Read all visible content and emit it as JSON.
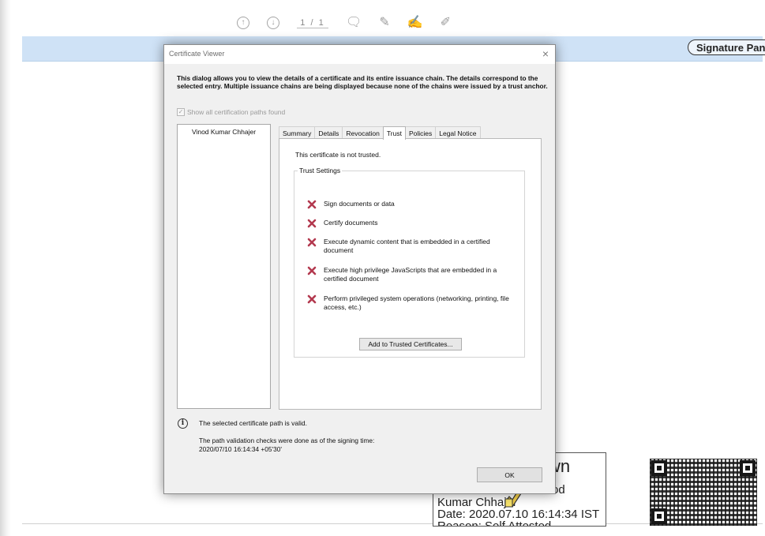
{
  "app": {
    "page_indicator": "1 / 1",
    "signature_panel_label": "Signature Panel"
  },
  "stamp": {
    "big_text": "wn",
    "line1": "od",
    "line2": "Kumar Chhajer",
    "line3": "Date: 2020.07.10 16:14:34 IST",
    "line4": "Reason: Self Attested"
  },
  "dialog": {
    "title": "Certificate Viewer",
    "close_glyph": "×",
    "description": "This dialog allows you to view the details of a certificate and its entire issuance chain. The details correspond to the selected entry. Multiple issuance chains are being displayed because none of the chains were issued by a trust anchor.",
    "show_all_label": "Show all certification paths found",
    "chain_items": [
      "Vinod Kumar Chhajer"
    ],
    "tabs": [
      "Summary",
      "Details",
      "Revocation",
      "Trust",
      "Policies",
      "Legal Notice"
    ],
    "active_tab": "Trust",
    "trust_status": "This certificate is not trusted.",
    "trust_settings_label": "Trust Settings",
    "permissions": [
      "Sign documents or data",
      "Certify documents",
      "Execute dynamic content that is embedded in a certified document",
      "Execute high privilege JavaScripts that are embedded in a certified document",
      "Perform privileged system operations (networking, printing, file access, etc.)"
    ],
    "add_trusted_label": "Add to Trusted Certificates...",
    "path_valid_text": "The selected certificate path is valid.",
    "validation_line1": "The path validation checks were done as of the signing time:",
    "validation_line2": "2020/07/10 16:14:34 +05'30'",
    "ok_label": "OK"
  },
  "colors": {
    "x_mark": "#b3394f",
    "signature_bar": "#cfe2f6"
  }
}
